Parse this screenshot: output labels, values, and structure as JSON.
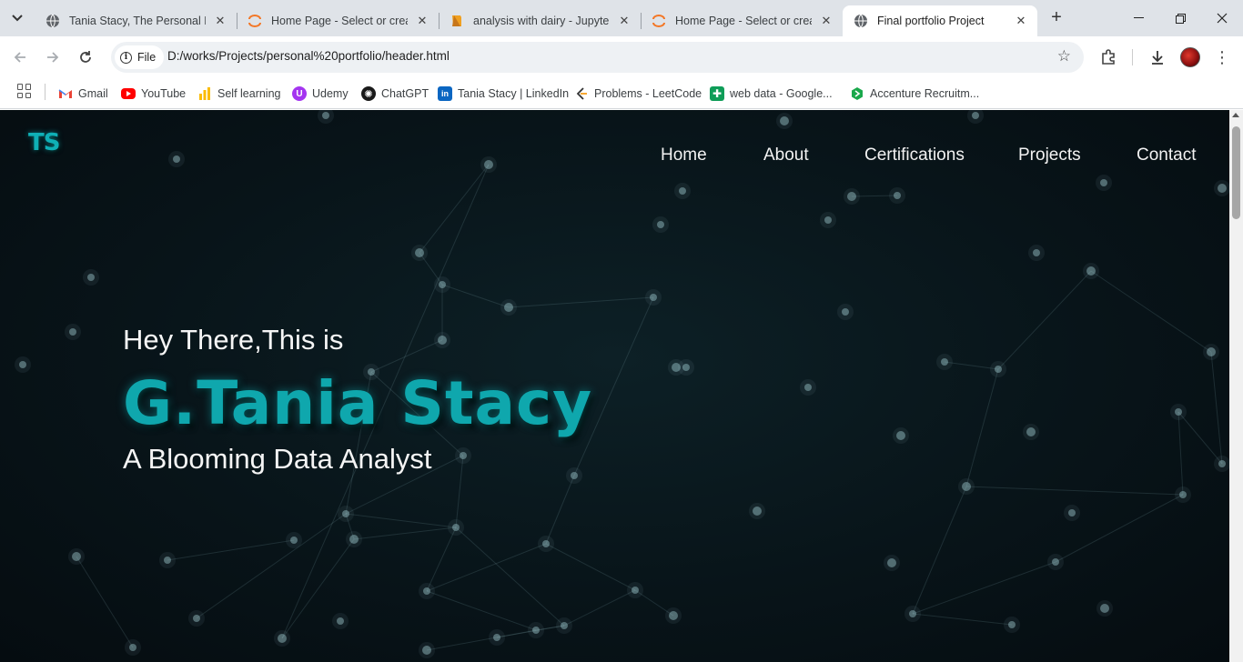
{
  "browser": {
    "tabs": [
      {
        "title": "Tania Stacy, The Personal Po",
        "favicon": "globe-icon",
        "active": false
      },
      {
        "title": "Home Page - Select or creat",
        "favicon": "jupyter-icon",
        "active": false
      },
      {
        "title": "analysis with dairy - Jupyter",
        "favicon": "notebook-icon",
        "active": false
      },
      {
        "title": "Home Page - Select or creat",
        "favicon": "jupyter-icon",
        "active": false
      },
      {
        "title": "Final portfolio Project",
        "favicon": "globe-icon",
        "active": true
      }
    ],
    "address": {
      "chip_label": "File",
      "url": "D:/works/Projects/personal%20portfolio/header.html"
    },
    "bookmarks": [
      {
        "label": "Gmail",
        "icon": "gmail-icon"
      },
      {
        "label": "YouTube",
        "icon": "youtube-icon"
      },
      {
        "label": "Self learning",
        "icon": "chart-bars-icon"
      },
      {
        "label": "Udemy",
        "icon": "udemy-icon"
      },
      {
        "label": "ChatGPT",
        "icon": "chatgpt-icon"
      },
      {
        "label": "Tania Stacy | LinkedIn",
        "icon": "linkedin-icon"
      },
      {
        "label": "Problems - LeetCode",
        "icon": "leetcode-icon"
      },
      {
        "label": "web data - Google...",
        "icon": "google-sheets-icon"
      },
      {
        "label": "Accenture Recruitm...",
        "icon": "accenture-icon"
      }
    ]
  },
  "page": {
    "logo": "TS",
    "nav": [
      "Home",
      "About",
      "Certifications",
      "Projects",
      "Contact"
    ],
    "hero": {
      "greeting": "Hey There,This is",
      "name": "G.Tania Stacy",
      "role": "A Blooming Data Analyst"
    },
    "accent_color": "#0fa7ad",
    "background_color": "#081419"
  }
}
